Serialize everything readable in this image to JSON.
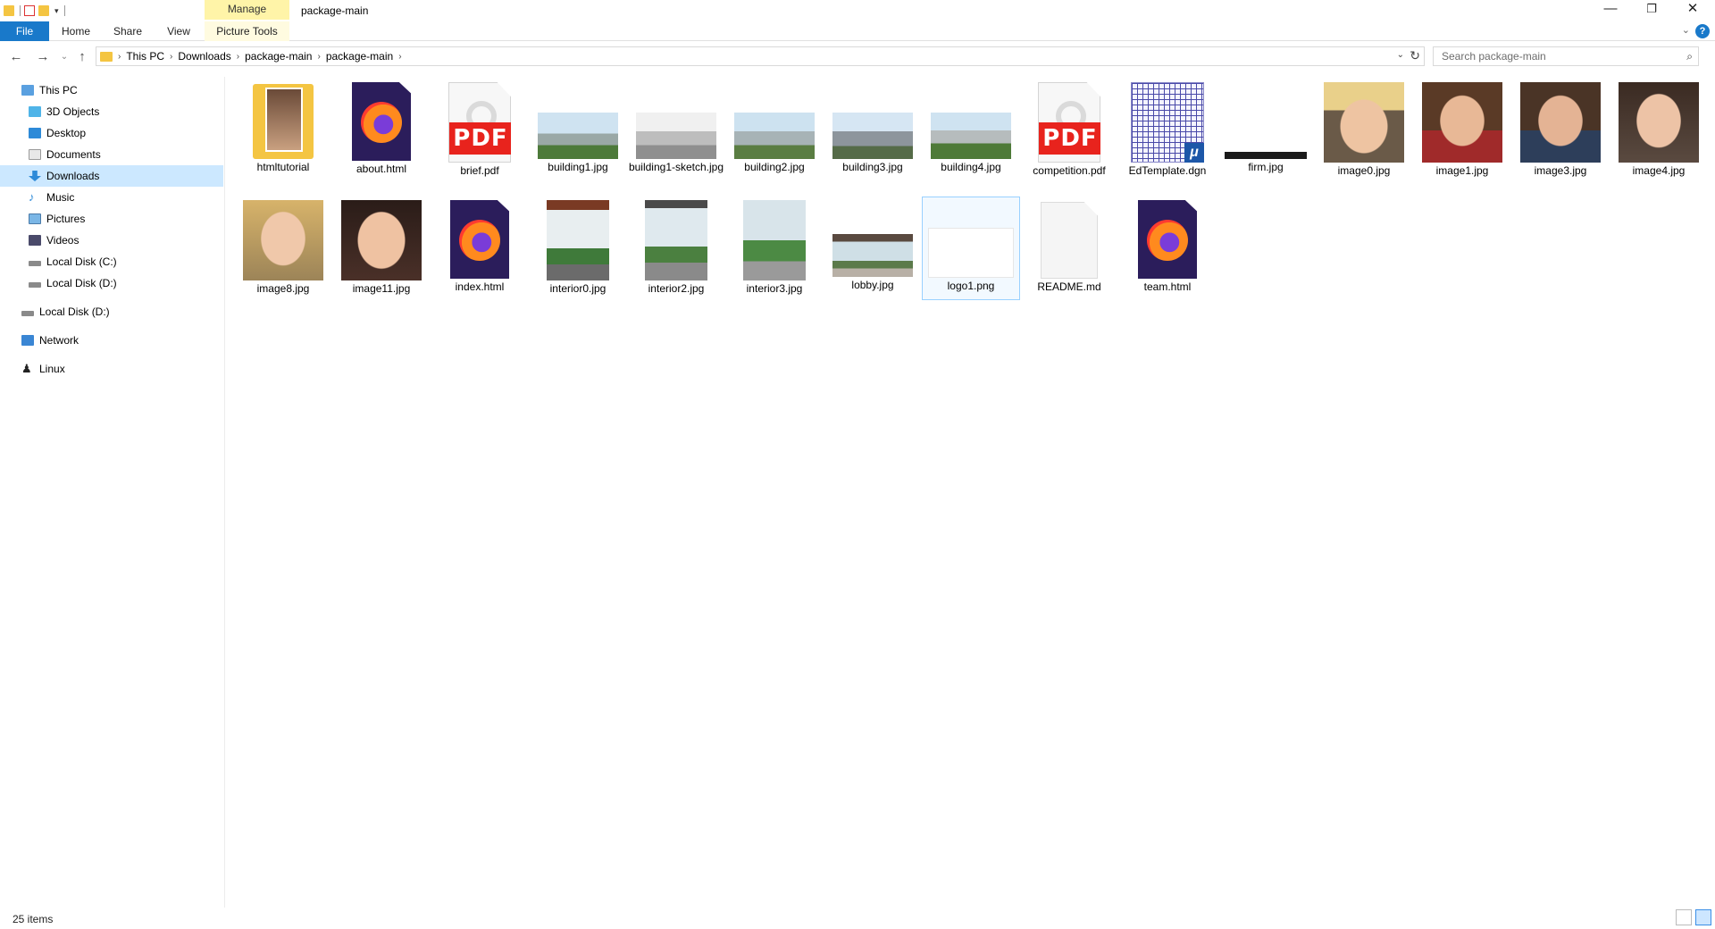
{
  "window": {
    "title": "package-main",
    "manage_label": "Manage",
    "minimize_glyph": "—",
    "restore_glyph": "❐",
    "close_glyph": "✕"
  },
  "ribbon": {
    "tabs": [
      "File",
      "Home",
      "Share",
      "View",
      "Picture Tools"
    ],
    "help_glyph": "?"
  },
  "address": {
    "crumbs": [
      "This PC",
      "Downloads",
      "package-main",
      "package-main"
    ],
    "search_placeholder": "Search package-main"
  },
  "nav": {
    "items": [
      {
        "label": "This PC",
        "icon": "monitor-icon"
      },
      {
        "label": "3D Objects",
        "icon": "cube-icon"
      },
      {
        "label": "Desktop",
        "icon": "desktop-icon"
      },
      {
        "label": "Documents",
        "icon": "documents-icon"
      },
      {
        "label": "Downloads",
        "icon": "download-arrow-icon",
        "selected": true
      },
      {
        "label": "Music",
        "icon": "music-note-icon"
      },
      {
        "label": "Pictures",
        "icon": "pictures-icon"
      },
      {
        "label": "Videos",
        "icon": "film-icon"
      },
      {
        "label": "Local Disk (C:)",
        "icon": "drive-icon"
      },
      {
        "label": "Local Disk (D:)",
        "icon": "drive-icon"
      },
      {
        "label": "Local Disk (D:)",
        "icon": "drive-icon"
      },
      {
        "label": "Network",
        "icon": "network-icon"
      },
      {
        "label": "Linux",
        "icon": "penguin-icon"
      }
    ]
  },
  "files": [
    {
      "name": "htmltutorial",
      "kind": "folder"
    },
    {
      "name": "about.html",
      "kind": "firefox"
    },
    {
      "name": "brief.pdf",
      "kind": "pdf"
    },
    {
      "name": "building1.jpg",
      "kind": "photo-wide"
    },
    {
      "name": "building1-sketch.jpg",
      "kind": "photo-wide-gray"
    },
    {
      "name": "building2.jpg",
      "kind": "photo-wide"
    },
    {
      "name": "building3.jpg",
      "kind": "photo-wide"
    },
    {
      "name": "building4.jpg",
      "kind": "photo-wide"
    },
    {
      "name": "competition.pdf",
      "kind": "pdf"
    },
    {
      "name": "EdTemplate.dgn",
      "kind": "dgn"
    },
    {
      "name": "firm.jpg",
      "kind": "banner"
    },
    {
      "name": "image0.jpg",
      "kind": "portrait-square"
    },
    {
      "name": "image1.jpg",
      "kind": "portrait-square"
    },
    {
      "name": "image3.jpg",
      "kind": "portrait-square"
    },
    {
      "name": "image4.jpg",
      "kind": "portrait-square"
    },
    {
      "name": "image8.jpg",
      "kind": "portrait-square"
    },
    {
      "name": "image11.jpg",
      "kind": "portrait-square"
    },
    {
      "name": "index.html",
      "kind": "firefox"
    },
    {
      "name": "interior0.jpg",
      "kind": "photo-tall"
    },
    {
      "name": "interior2.jpg",
      "kind": "photo-tall"
    },
    {
      "name": "interior3.jpg",
      "kind": "photo-tall"
    },
    {
      "name": "lobby.jpg",
      "kind": "photo-lobby"
    },
    {
      "name": "logo1.png",
      "kind": "logo",
      "selected": true
    },
    {
      "name": "README.md",
      "kind": "blank"
    },
    {
      "name": "team.html",
      "kind": "firefox"
    }
  ],
  "status": {
    "item_count": "25 items"
  },
  "colors": {
    "accent": "#1979ca",
    "selection": "#cce8ff",
    "manage_band": "#fff4a8",
    "pdf_red": "#e8231d"
  }
}
